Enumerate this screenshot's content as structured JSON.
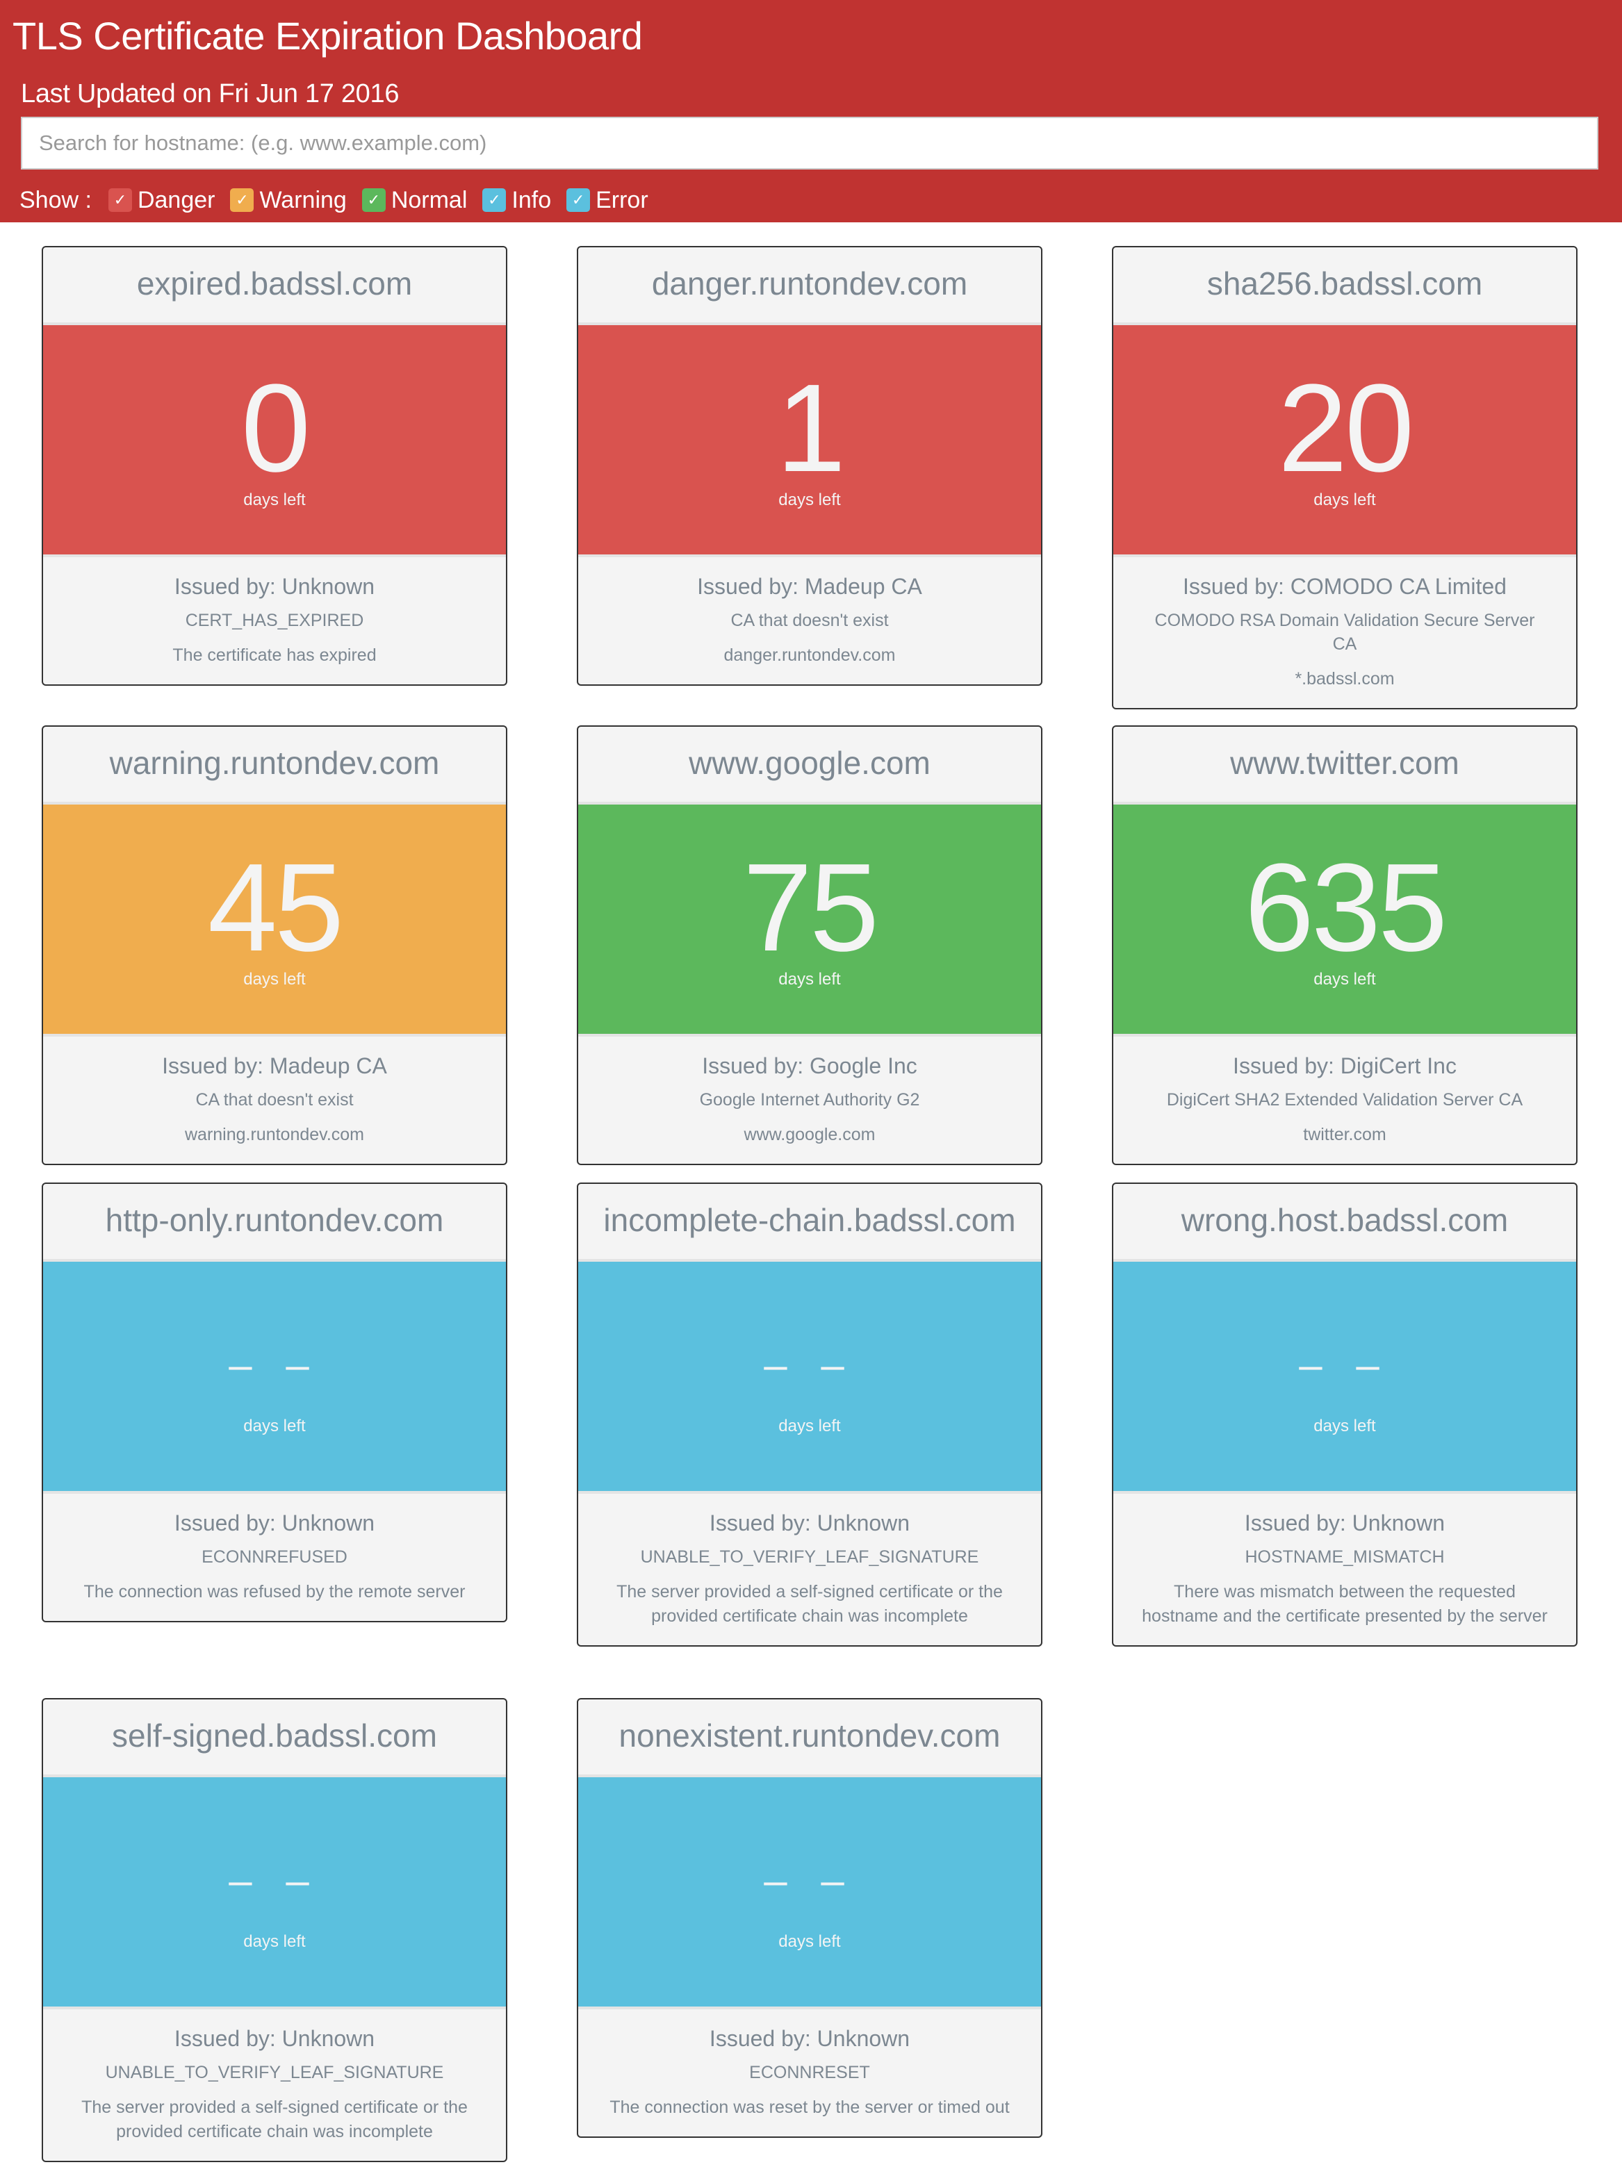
{
  "header": {
    "title": "TLS Certificate Expiration Dashboard",
    "last_updated": "Last Updated on Fri Jun 17 2016",
    "search_placeholder": "Search for hostname: (e.g. www.example.com)",
    "search_value": "",
    "show_label": "Show :",
    "filters": [
      {
        "label": "Danger",
        "checked": true,
        "color": "#d9534f"
      },
      {
        "label": "Warning",
        "checked": true,
        "color": "#f0ad4e"
      },
      {
        "label": "Normal",
        "checked": true,
        "color": "#5cb85c"
      },
      {
        "label": "Info",
        "checked": true,
        "color": "#5bc0de"
      },
      {
        "label": "Error",
        "checked": true,
        "color": "#5bc0de"
      }
    ],
    "check_glyph": "✓"
  },
  "colors": {
    "header_bg": "#c03331",
    "danger": "#d9534f",
    "warning": "#f0ad4e",
    "normal": "#5cb85c",
    "info": "#5bc0de"
  },
  "days_label": "days left",
  "cards": [
    {
      "host": "expired.badssl.com",
      "days": "0",
      "status": "danger",
      "issuer": "Issued by: Unknown",
      "code": "CERT_HAS_EXPIRED",
      "desc": "The certificate has expired"
    },
    {
      "host": "danger.runtondev.com",
      "days": "1",
      "status": "danger",
      "issuer": "Issued by: Madeup CA",
      "code": "CA that doesn't exist",
      "desc": "danger.runtondev.com"
    },
    {
      "host": "sha256.badssl.com",
      "days": "20",
      "status": "danger",
      "issuer": "Issued by: COMODO CA Limited",
      "code": "COMODO RSA Domain Validation Secure Server CA",
      "desc": "*.badssl.com"
    },
    {
      "host": "warning.runtondev.com",
      "days": "45",
      "status": "warning",
      "issuer": "Issued by: Madeup CA",
      "code": "CA that doesn't exist",
      "desc": "warning.runtondev.com"
    },
    {
      "host": "www.google.com",
      "days": "75",
      "status": "normal",
      "issuer": "Issued by: Google Inc",
      "code": "Google Internet Authority G2",
      "desc": "www.google.com"
    },
    {
      "host": "www.twitter.com",
      "days": "635",
      "status": "normal",
      "issuer": "Issued by: DigiCert Inc",
      "code": "DigiCert SHA2 Extended Validation Server CA",
      "desc": "twitter.com"
    },
    {
      "host": "http-only.runtondev.com",
      "days": "– –",
      "status": "info",
      "issuer": "Issued by: Unknown",
      "code": "ECONNREFUSED",
      "desc": "The connection was refused by the remote server"
    },
    {
      "host": "incomplete-chain.badssl.com",
      "days": "– –",
      "status": "info",
      "issuer": "Issued by: Unknown",
      "code": "UNABLE_TO_VERIFY_LEAF_SIGNATURE",
      "desc": "The server provided a self-signed certificate or the provided certificate chain was incomplete"
    },
    {
      "host": "wrong.host.badssl.com",
      "days": "– –",
      "status": "info",
      "issuer": "Issued by: Unknown",
      "code": "HOSTNAME_MISMATCH",
      "desc": "There was mismatch between the requested hostname and the certificate presented by the server"
    },
    {
      "host": "self-signed.badssl.com",
      "days": "– –",
      "status": "info",
      "issuer": "Issued by: Unknown",
      "code": "UNABLE_TO_VERIFY_LEAF_SIGNATURE",
      "desc": "The server provided a self-signed certificate or the provided certificate chain was incomplete"
    },
    {
      "host": "nonexistent.runtondev.com",
      "days": "– –",
      "status": "info",
      "issuer": "Issued by: Unknown",
      "code": "ECONNRESET",
      "desc": "The connection was reset by the server or timed out"
    }
  ]
}
